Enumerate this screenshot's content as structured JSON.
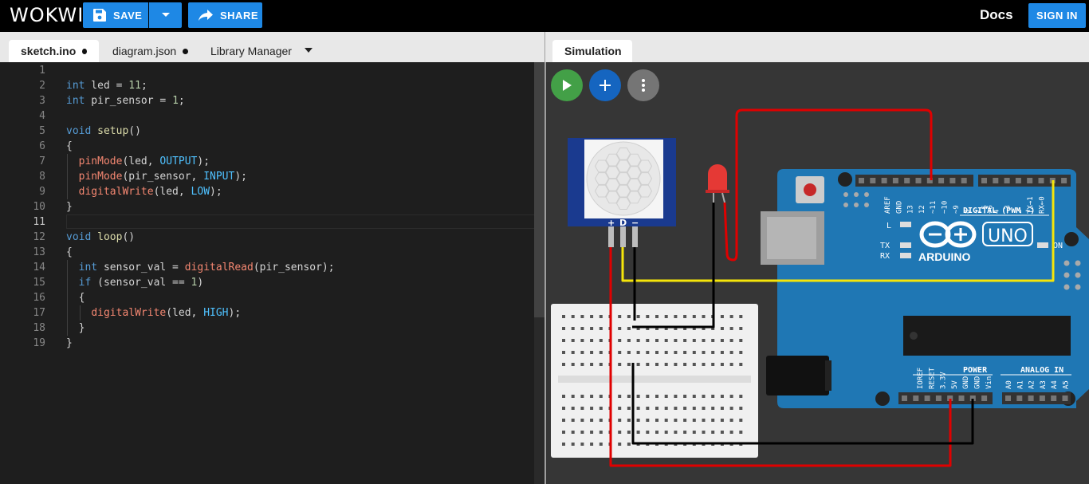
{
  "header": {
    "logo": "WOKWI",
    "save_label": "SAVE",
    "share_label": "SHARE",
    "docs_label": "Docs",
    "signin_label": "SIGN IN",
    "colors": {
      "accent": "#1e88e5",
      "bar": "#000000"
    }
  },
  "editor": {
    "tabs": [
      {
        "label": "sketch.ino",
        "modified": true,
        "active": true
      },
      {
        "label": "diagram.json",
        "modified": true,
        "active": false
      },
      {
        "label": "Library Manager",
        "modified": false,
        "active": false
      }
    ],
    "current_line": 11,
    "lines": [
      {
        "n": "1",
        "text": ""
      },
      {
        "n": "2",
        "text": "int led = 11;"
      },
      {
        "n": "3",
        "text": "int pir_sensor = 1;"
      },
      {
        "n": "4",
        "text": ""
      },
      {
        "n": "5",
        "text": "void setup()"
      },
      {
        "n": "6",
        "text": "{"
      },
      {
        "n": "7",
        "text": "  pinMode(led, OUTPUT);"
      },
      {
        "n": "8",
        "text": "  pinMode(pir_sensor, INPUT);"
      },
      {
        "n": "9",
        "text": "  digitalWrite(led, LOW);"
      },
      {
        "n": "10",
        "text": "}"
      },
      {
        "n": "11",
        "text": ""
      },
      {
        "n": "12",
        "text": "void loop()"
      },
      {
        "n": "13",
        "text": "{"
      },
      {
        "n": "14",
        "text": "  int sensor_val = digitalRead(pir_sensor);"
      },
      {
        "n": "15",
        "text": "  if (sensor_val == 1)"
      },
      {
        "n": "16",
        "text": "  {"
      },
      {
        "n": "17",
        "text": "    digitalWrite(led, HIGH);"
      },
      {
        "n": "18",
        "text": "  }"
      },
      {
        "n": "19",
        "text": "}"
      }
    ]
  },
  "simulation": {
    "tab_label": "Simulation",
    "controls": [
      {
        "name": "play-icon",
        "color": "#43a047"
      },
      {
        "name": "plus-icon",
        "color": "#1565c0"
      },
      {
        "name": "more-vert-icon",
        "color": "#757575"
      }
    ],
    "pir": {
      "pins": [
        "+",
        "D",
        "−"
      ]
    },
    "arduino": {
      "brand": "ARDUINO",
      "model": "UNO",
      "digital_label": "DIGITAL (PWM ~)",
      "digital_pins": [
        "AREF",
        "GND",
        "13",
        "12",
        "~11",
        "~10",
        "~9",
        "8",
        "7",
        "~6",
        "~5",
        "4",
        "~3",
        "2",
        "TX→1",
        "RX←0"
      ],
      "power_label": "POWER",
      "power_pins": [
        "IOREF",
        "RESET",
        "3.3V",
        "5V",
        "GND",
        "GND",
        "Vin"
      ],
      "analog_label": "ANALOG IN",
      "analog_pins": [
        "A0",
        "A1",
        "A2",
        "A3",
        "A4",
        "A5"
      ],
      "led_labels": [
        "L",
        "TX",
        "RX",
        "ON"
      ]
    }
  }
}
